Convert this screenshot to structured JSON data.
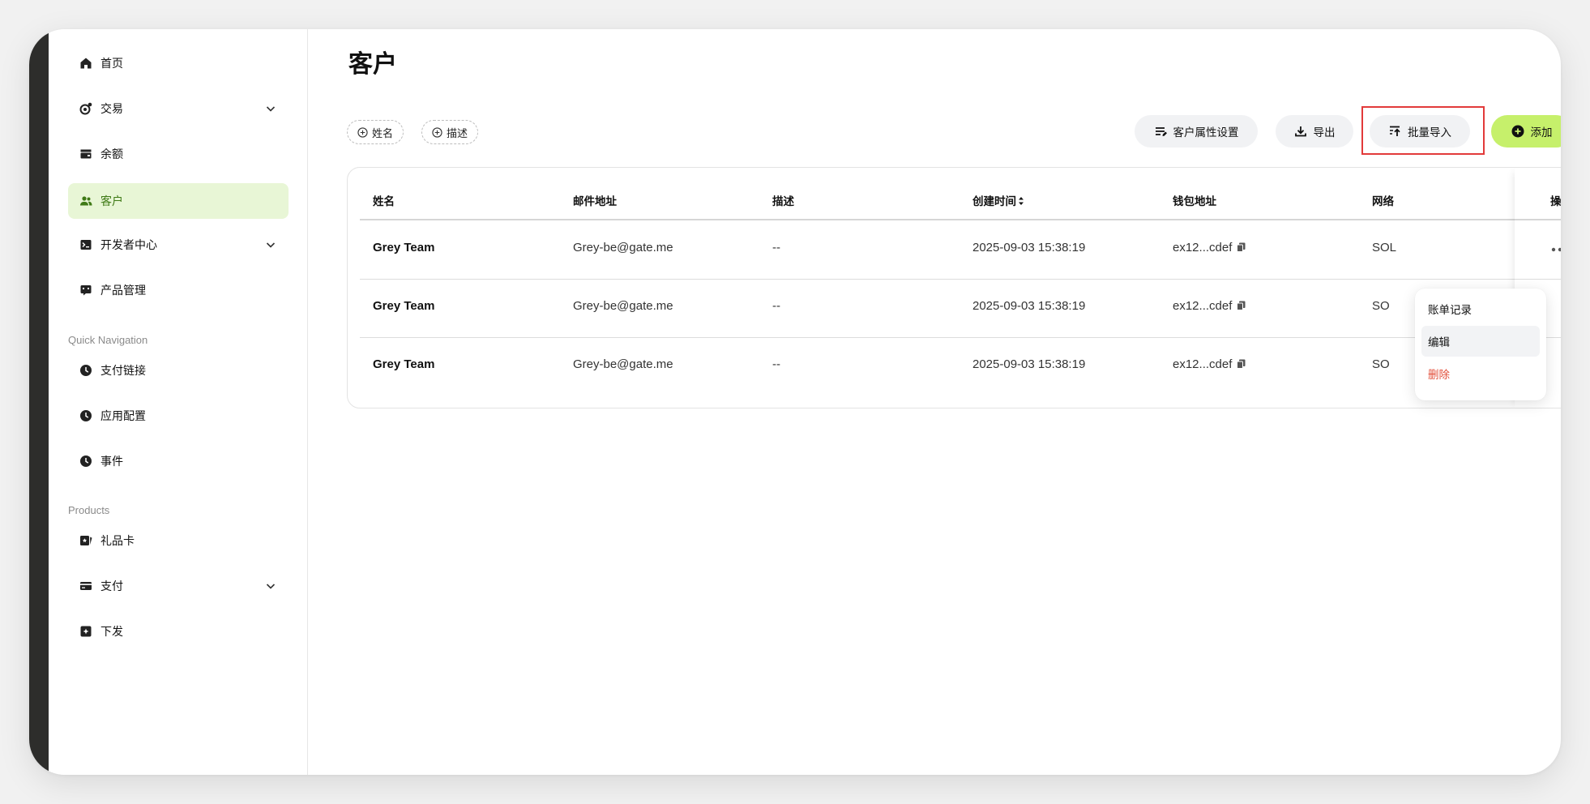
{
  "sidebar": {
    "items": [
      {
        "label": "首页",
        "icon": "home-icon"
      },
      {
        "label": "交易",
        "icon": "transaction-icon",
        "expandable": true
      },
      {
        "label": "余额",
        "icon": "wallet-icon"
      },
      {
        "label": "客户",
        "icon": "users-icon",
        "active": true
      },
      {
        "label": "开发者中心",
        "icon": "terminal-icon",
        "expandable": true
      },
      {
        "label": "产品管理",
        "icon": "product-icon"
      }
    ],
    "quick_nav_label": "Quick Navigation",
    "quick_nav": [
      {
        "label": "支付链接",
        "icon": "clock-icon"
      },
      {
        "label": "应用配置",
        "icon": "clock-icon"
      },
      {
        "label": "事件",
        "icon": "clock-icon"
      }
    ],
    "products_label": "Products",
    "products": [
      {
        "label": "礼品卡",
        "icon": "gift-card-icon"
      },
      {
        "label": "支付",
        "icon": "card-icon",
        "expandable": true
      },
      {
        "label": "下发",
        "icon": "payout-icon"
      }
    ]
  },
  "main": {
    "title": "客户",
    "filters": [
      "姓名",
      "描述"
    ],
    "actions": {
      "attributes": "客户属性设置",
      "export": "导出",
      "import": "批量导入",
      "add": "添加"
    },
    "table": {
      "columns": [
        "姓名",
        "邮件地址",
        "描述",
        "创建时间",
        "钱包地址",
        "网络",
        "操作"
      ],
      "rows": [
        {
          "name": "Grey Team",
          "email": "Grey-be@gate.me",
          "desc": "--",
          "created": "2025-09-03 15:38:19",
          "wallet": "ex12...cdef",
          "network": "SOL"
        },
        {
          "name": "Grey Team",
          "email": "Grey-be@gate.me",
          "desc": "--",
          "created": "2025-09-03 15:38:19",
          "wallet": "ex12...cdef",
          "network": "SO"
        },
        {
          "name": "Grey Team",
          "email": "Grey-be@gate.me",
          "desc": "--",
          "created": "2025-09-03 15:38:19",
          "wallet": "ex12...cdef",
          "network": "SO"
        }
      ]
    },
    "row_menu": {
      "items": [
        "账单记录",
        "编辑",
        "删除"
      ]
    }
  },
  "colors": {
    "accent": "#c6f06b",
    "active_bg": "#e8f6d6",
    "active_text": "#3f7a16",
    "danger": "#e2503b",
    "highlight": "#e23a3a"
  }
}
